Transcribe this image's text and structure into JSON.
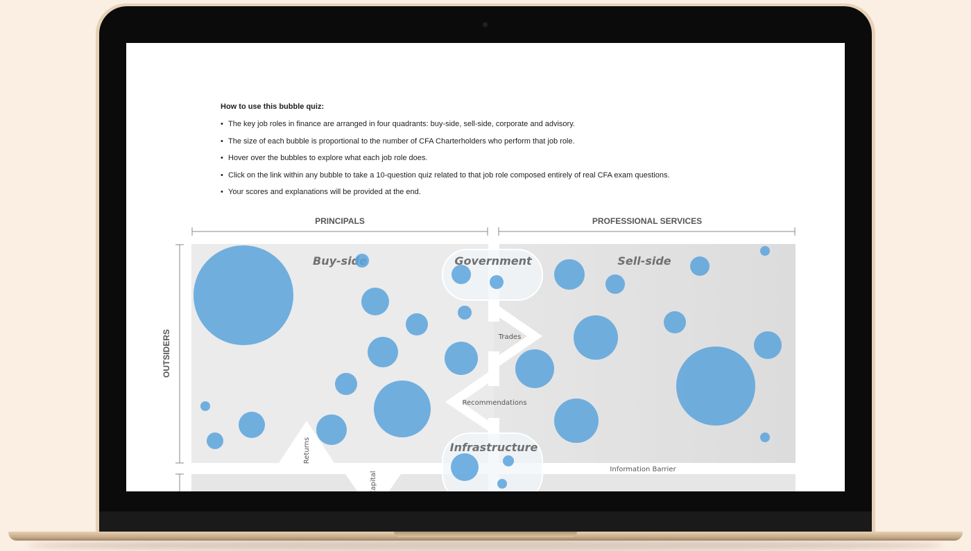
{
  "instructions": {
    "heading": "How to use this bubble quiz:",
    "items": [
      "The key job roles in finance are arranged in four quadrants: buy-side, sell-side, corporate and advisory.",
      "The size of each bubble is proportional to the number of CFA Charterholders who perform that job role.",
      "Hover over the bubbles to explore what each job role does.",
      "Click on the link within any bubble to take a 10-question quiz related to that job role composed entirely of real CFA exam questions.",
      "Your scores and explanations will be provided at the end."
    ]
  },
  "diagram": {
    "axis_principals": "PRINCIPALS",
    "axis_professional": "PROFESSIONAL SERVICES",
    "axis_outsiders": "OUTSIDERS",
    "quadrant_buy": "Buy-side",
    "quadrant_sell": "Sell-side",
    "government": "Government",
    "infrastructure": "Infrastructure",
    "trades": "Trades",
    "recommendations": "Recommendations",
    "returns": "Returns",
    "capital": "Capital",
    "information_barrier": "Information Barrier",
    "bubble_color": "#5ba3dc"
  }
}
